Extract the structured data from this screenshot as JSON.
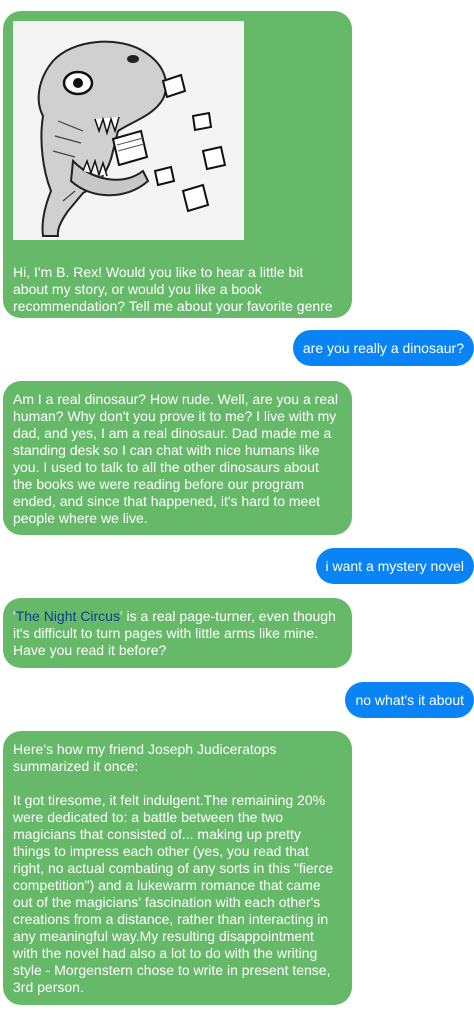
{
  "messages": {
    "m1": {
      "image_icon": "trex-skull-eating-books-illustration",
      "text": "Hi, I'm B. Rex! Would you like to hear a little bit about my story, or would you like a book recommendation? Tell me about your favorite genre or author."
    },
    "m2": {
      "text": "are you really a dinosaur?"
    },
    "m3": {
      "text": "Am I a real dinosaur? How rude. Well, are you a real human? Why don't you prove it to me? I live with my dad, and yes, I am a real dinosaur. Dad made me a standing desk so I can chat with nice humans like you. I used to talk to all the other dinosaurs about the books we were reading before our program ended, and since that happened, it's hard to meet people where we live."
    },
    "m4": {
      "text": "i want a mystery novel"
    },
    "m5": {
      "quote_open": "'",
      "link": "The Night Circus",
      "rest": "' is a real page-turner, even though it's difficult to turn pages with little arms like mine. Have you read it before?"
    },
    "m6": {
      "text": "no what's it about"
    },
    "m7": {
      "intro": "Here's how my friend Joseph Judiceratops summarized it once:",
      "body": "It got tiresome, it felt indulgent.The remaining 20% were dedicated to: a battle between the two magicians that consisted of... making up pretty things to impress each other (yes, you read that right, no actual combating of any sorts in this \"fierce competition\") and a lukewarm romance that came out of the magicians' fascination with each other's creations from a distance, rather than interacting in any meaningful way.My resulting disappointment with the novel had also a lot to do with the writing style - Morgenstern chose to write in present tense, 3rd person."
    }
  },
  "colors": {
    "bot_bubble": "#67b96a",
    "user_bubble": "#0a84f5",
    "link": "#103e8c"
  }
}
